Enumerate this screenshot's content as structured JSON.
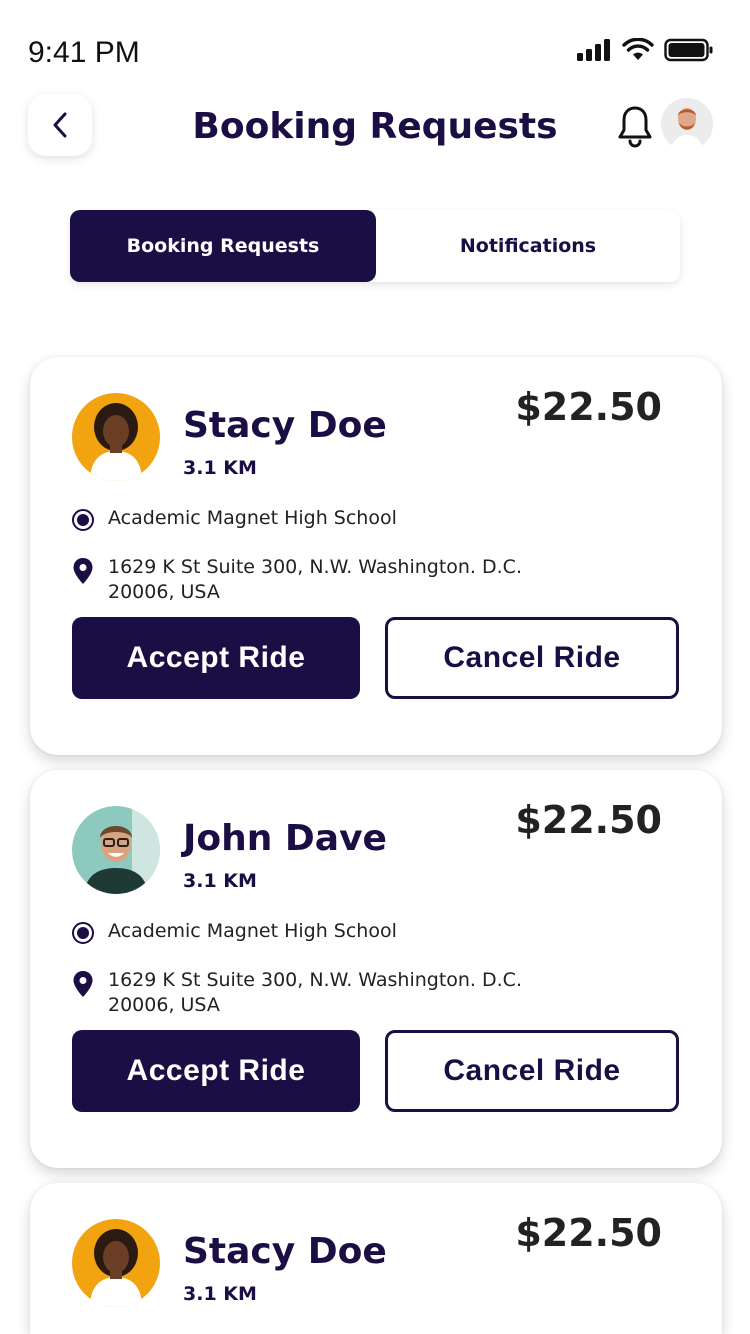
{
  "status_bar": {
    "time": "9:41 PM",
    "icons": [
      "cellular-signal-icon",
      "wifi-icon",
      "battery-icon"
    ]
  },
  "header": {
    "back_icon": "chevron-left-icon",
    "title": "Booking Requests",
    "bell_icon": "bell-icon",
    "avatar": "user-avatar"
  },
  "tabs": [
    {
      "label": "Booking Requests",
      "active": true
    },
    {
      "label": "Notifications",
      "active": false
    }
  ],
  "requests": [
    {
      "name": "Stacy Doe",
      "distance": "3.1 KM",
      "price": "$22.50",
      "pickup": "Academic Magnet High School",
      "dropoff": "1629 K St Suite 300, N.W. Washington. D.C. 20006, USA",
      "accept_label": "Accept Ride",
      "cancel_label": "Cancel Ride"
    },
    {
      "name": "John Dave",
      "distance": "3.1 KM",
      "price": "$22.50",
      "pickup": "Academic Magnet High School",
      "dropoff": "1629 K St Suite 300, N.W. Washington. D.C. 20006, USA",
      "accept_label": "Accept Ride",
      "cancel_label": "Cancel Ride"
    },
    {
      "name": "Stacy Doe",
      "distance": "3.1 KM",
      "price": "$22.50"
    }
  ],
  "colors": {
    "primary": "#1b0e45",
    "background": "#ffffff",
    "avatar_orange": "#f2a310",
    "avatar_teal": "#8ec9c0"
  }
}
